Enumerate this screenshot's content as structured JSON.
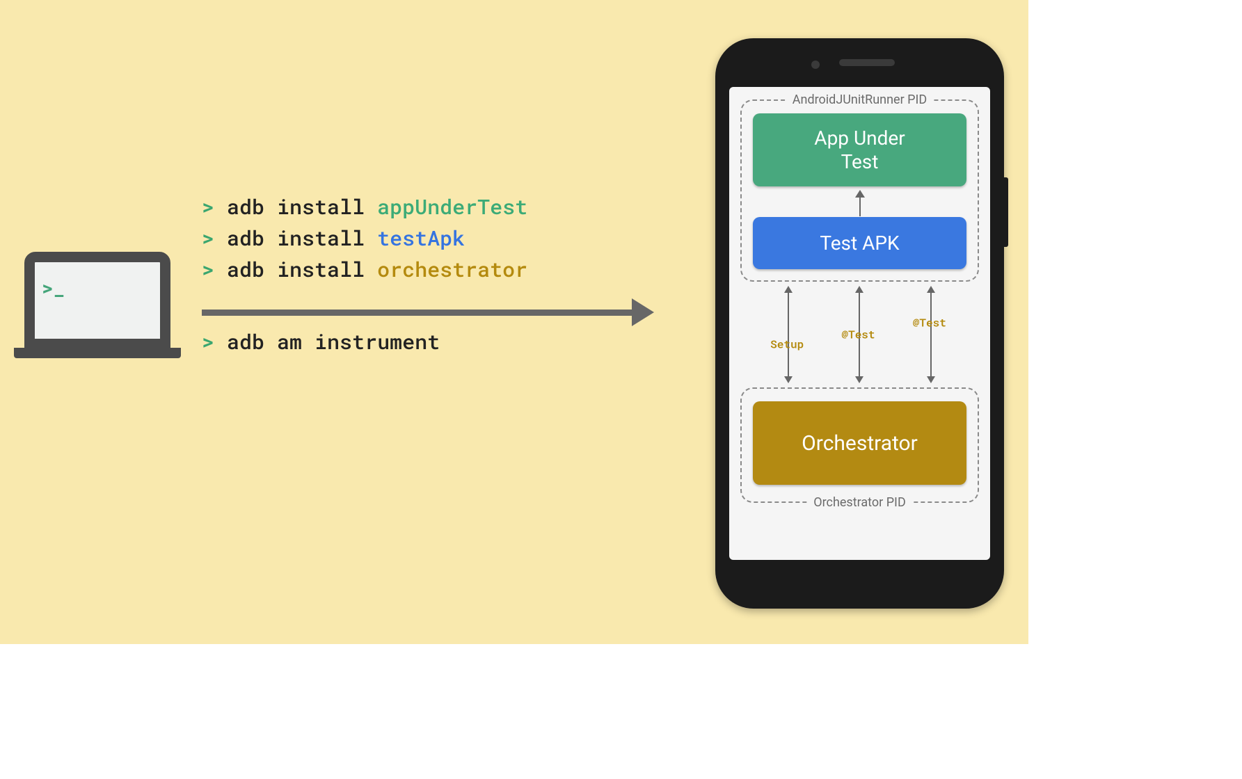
{
  "laptop": {
    "prompt": ">_"
  },
  "commands": {
    "lines": [
      {
        "prompt": ">",
        "cmd": "adb install",
        "arg": "appUnderTest",
        "arg_class": "arg-green"
      },
      {
        "prompt": ">",
        "cmd": "adb install",
        "arg": "testApk",
        "arg_class": "arg-blue"
      },
      {
        "prompt": ">",
        "cmd": "adb install",
        "arg": "orchestrator",
        "arg_class": "arg-gold"
      }
    ],
    "after_arrow": {
      "prompt": ">",
      "cmd": "adb am instrument"
    }
  },
  "phone": {
    "top_process_label": "AndroidJUnitRunner PID",
    "app_under_test": "App Under Test",
    "test_apk": "Test APK",
    "arrow_labels": [
      "Setup",
      "@Test",
      "@Test"
    ],
    "orchestrator": "Orchestrator",
    "bottom_process_label": "Orchestrator PID"
  }
}
